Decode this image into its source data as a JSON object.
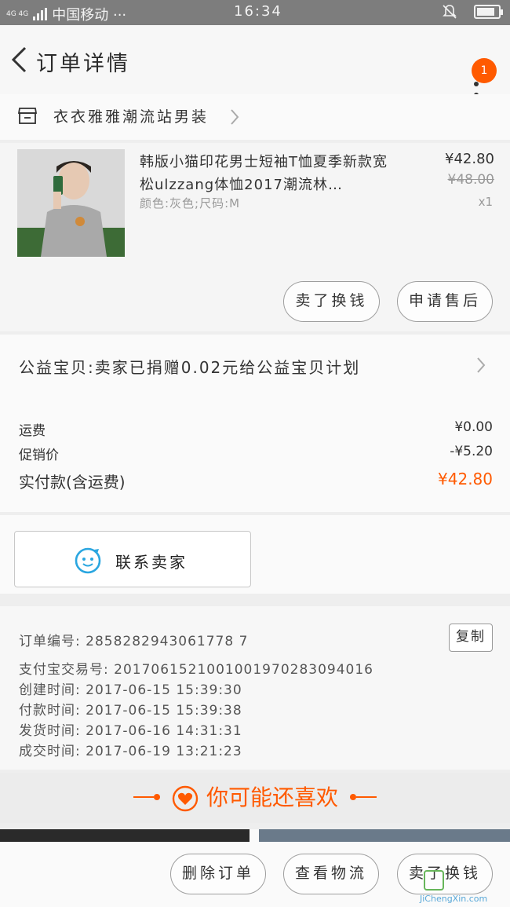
{
  "status_bar": {
    "network": "4G 4G",
    "carrier": "中国移动 ···",
    "time": "16:34"
  },
  "header": {
    "title": "订单详情",
    "badge_count": "1"
  },
  "store": {
    "name": "衣衣雅雅潮流站男装"
  },
  "product": {
    "title": "韩版小猫印花男士短袖T恤夏季新款宽松ulzzang体恤2017潮流林…",
    "sku": "颜色:灰色;尺码:M",
    "price": "¥42.80",
    "original_price": "¥48.00",
    "quantity": "x1",
    "actions": [
      "卖了换钱",
      "申请售后"
    ]
  },
  "charity": {
    "text": "公益宝贝:卖家已捐赠0.02元给公益宝贝计划"
  },
  "fees": [
    {
      "label": "运费",
      "value": "¥0.00"
    },
    {
      "label": "促销价",
      "value": "-¥5.20"
    }
  ],
  "total": {
    "label": "实付款(含运费)",
    "value": "¥42.80"
  },
  "contact": {
    "label": "联系卖家"
  },
  "order_info": {
    "order_no": "订单编号: 2858282943061778 7",
    "alipay_no": "支付宝交易号: 2017061521001001970283094016",
    "created": "创建时间: 2017-06-15 15:39:30",
    "paid": "付款时间: 2017-06-15 15:39:38",
    "shipped": "发货时间: 2017-06-16 14:31:31",
    "completed": "成交时间: 2017-06-19 13:21:23",
    "copy_label": "复制"
  },
  "recommend": {
    "title": "你可能还喜欢"
  },
  "bottom_bar": {
    "buttons": [
      "删除订单",
      "查看物流",
      "卖了换钱"
    ]
  },
  "watermark": "JiChengXin.com",
  "colors": {
    "accent": "#ff5a00",
    "status_bar": "#7d7d7d",
    "contact_icon": "#2aa6e0"
  }
}
